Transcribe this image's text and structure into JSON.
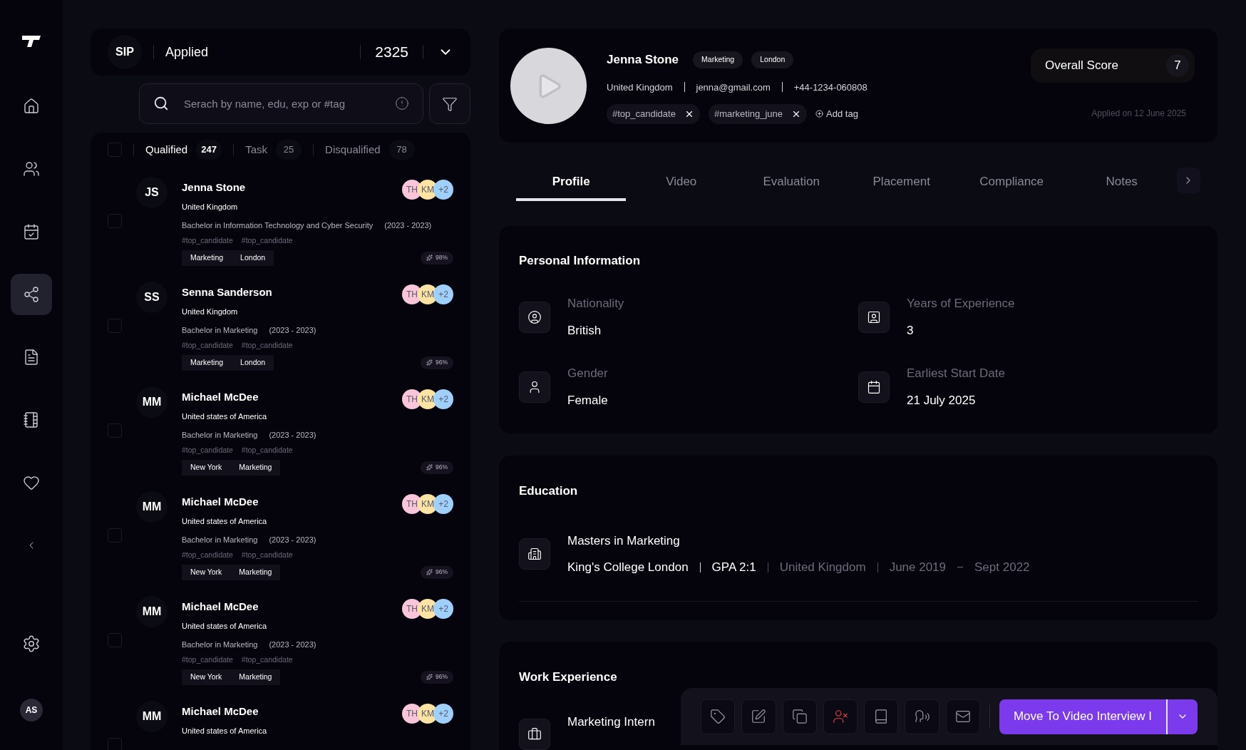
{
  "sidebar": {
    "avatar": "AS",
    "items": [
      {
        "selected": false
      },
      {
        "selected": false
      },
      {
        "selected": false
      },
      {
        "selected": true
      },
      {
        "selected": false
      },
      {
        "selected": false
      },
      {
        "selected": false
      },
      {
        "selected": false
      }
    ]
  },
  "stage": {
    "code": "SIP",
    "name": "Applied",
    "count": "2325"
  },
  "search": {
    "placeholder": "Serach by name, edu, exp or #tag"
  },
  "list_tabs": [
    {
      "label": "Qualified",
      "count": "247",
      "selected": true
    },
    {
      "label": "Task",
      "count": "25",
      "selected": false
    },
    {
      "label": "Disqualified",
      "count": "78",
      "selected": false
    }
  ],
  "select_all": {
    "checked": false
  },
  "candidates": [
    {
      "initials": "JS",
      "name": "Jenna Stone",
      "country": "United Kingdom",
      "education": "Bachelor in Information Technology and Cyber Security",
      "years": "(2023 - 2023)",
      "tags": [
        "#top_candidate",
        "#top_candidate"
      ],
      "chips": [
        "Marketing",
        "London"
      ],
      "score": "98%",
      "checked": false,
      "reviewers": [
        {
          "text": "TH",
          "color": "#f9c6d9"
        },
        {
          "text": "KM",
          "color": "#fbe3a4"
        },
        {
          "text": "+2",
          "color": "#9fd0fb"
        }
      ]
    },
    {
      "initials": "SS",
      "name": "Senna Sanderson",
      "country": "United Kingdom",
      "education": "Bachelor in Marketing",
      "years": "(2023 - 2023)",
      "tags": [
        "#top_candidate",
        "#top_candidate"
      ],
      "chips": [
        "Marketing",
        "London"
      ],
      "score": "96%",
      "checked": false,
      "reviewers": [
        {
          "text": "TH",
          "color": "#f9c6d9"
        },
        {
          "text": "KM",
          "color": "#fbe3a4"
        },
        {
          "text": "+2",
          "color": "#9fd0fb"
        }
      ]
    },
    {
      "initials": "MM",
      "name": "Michael McDee",
      "country": "United states of America",
      "education": "Bachelor in Marketing",
      "years": "(2023 - 2023)",
      "tags": [
        "#top_candidate",
        "#top_candidate"
      ],
      "chips": [
        "New York",
        "Marketing"
      ],
      "score": "96%",
      "checked": false,
      "reviewers": [
        {
          "text": "TH",
          "color": "#f9c6d9"
        },
        {
          "text": "KM",
          "color": "#fbe3a4"
        },
        {
          "text": "+2",
          "color": "#9fd0fb"
        }
      ]
    },
    {
      "initials": "MM",
      "name": "Michael McDee",
      "country": "United states of America",
      "education": "Bachelor in Marketing",
      "years": "(2023 - 2023)",
      "tags": [
        "#top_candidate",
        "#top_candidate"
      ],
      "chips": [
        "New York",
        "Marketing"
      ],
      "score": "96%",
      "checked": false,
      "reviewers": [
        {
          "text": "TH",
          "color": "#f9c6d9"
        },
        {
          "text": "KM",
          "color": "#fbe3a4"
        },
        {
          "text": "+2",
          "color": "#9fd0fb"
        }
      ]
    },
    {
      "initials": "MM",
      "name": "Michael McDee",
      "country": "United states of America",
      "education": "Bachelor in Marketing",
      "years": "(2023 - 2023)",
      "tags": [
        "#top_candidate",
        "#top_candidate"
      ],
      "chips": [
        "New York",
        "Marketing"
      ],
      "score": "96%",
      "checked": false,
      "reviewers": [
        {
          "text": "TH",
          "color": "#f9c6d9"
        },
        {
          "text": "KM",
          "color": "#fbe3a4"
        },
        {
          "text": "+2",
          "color": "#9fd0fb"
        }
      ]
    },
    {
      "initials": "MM",
      "name": "Michael McDee",
      "country": "United states of America",
      "checked": false,
      "reviewers": [
        {
          "text": "TH",
          "color": "#f9c6d9"
        },
        {
          "text": "KM",
          "color": "#fbe3a4"
        },
        {
          "text": "+2",
          "color": "#9fd0fb"
        }
      ]
    }
  ],
  "profile": {
    "name": "Jenna Stone",
    "badges": [
      "Marketing",
      "London"
    ],
    "country": "United Kingdom",
    "email": "jenna@gmail.com",
    "phone": "+44-1234-060808",
    "tags": [
      "#top_candidate",
      "#marketing_june"
    ],
    "add_tag": "Add tag",
    "score_label": "Overall Score",
    "score": "7",
    "applied": "Applied on 12 June 2025"
  },
  "tabs": [
    {
      "label": "Profile",
      "selected": true
    },
    {
      "label": "Video",
      "selected": false
    },
    {
      "label": "Evaluation",
      "selected": false
    },
    {
      "label": "Placement",
      "selected": false
    },
    {
      "label": "Compliance",
      "selected": false
    },
    {
      "label": "Notes",
      "selected": false
    }
  ],
  "personal": {
    "title": "Personal Information",
    "fields": [
      {
        "label": "Nationality",
        "value": "British"
      },
      {
        "label": "Years of Experience",
        "value": "3"
      },
      {
        "label": "Gender",
        "value": "Female"
      },
      {
        "label": "Earliest Start Date",
        "value": "21 July 2025"
      }
    ]
  },
  "education": {
    "title": "Education",
    "items": [
      {
        "degree": "Masters in Marketing",
        "school": "King's College London",
        "gpa": "GPA 2:1",
        "country": "United Kingdom",
        "start": "June 2019",
        "end": "Sept 2022"
      }
    ]
  },
  "work": {
    "title": "Work Experience",
    "items": [
      {
        "role": "Marketing Intern"
      }
    ]
  },
  "actions": {
    "tools": [
      {
        "kind": "normal"
      },
      {
        "kind": "normal"
      },
      {
        "kind": "normal"
      },
      {
        "kind": "danger"
      },
      {
        "kind": "normal"
      },
      {
        "kind": "normal"
      },
      {
        "kind": "normal"
      }
    ],
    "primary": "Move To Video Interview I"
  }
}
